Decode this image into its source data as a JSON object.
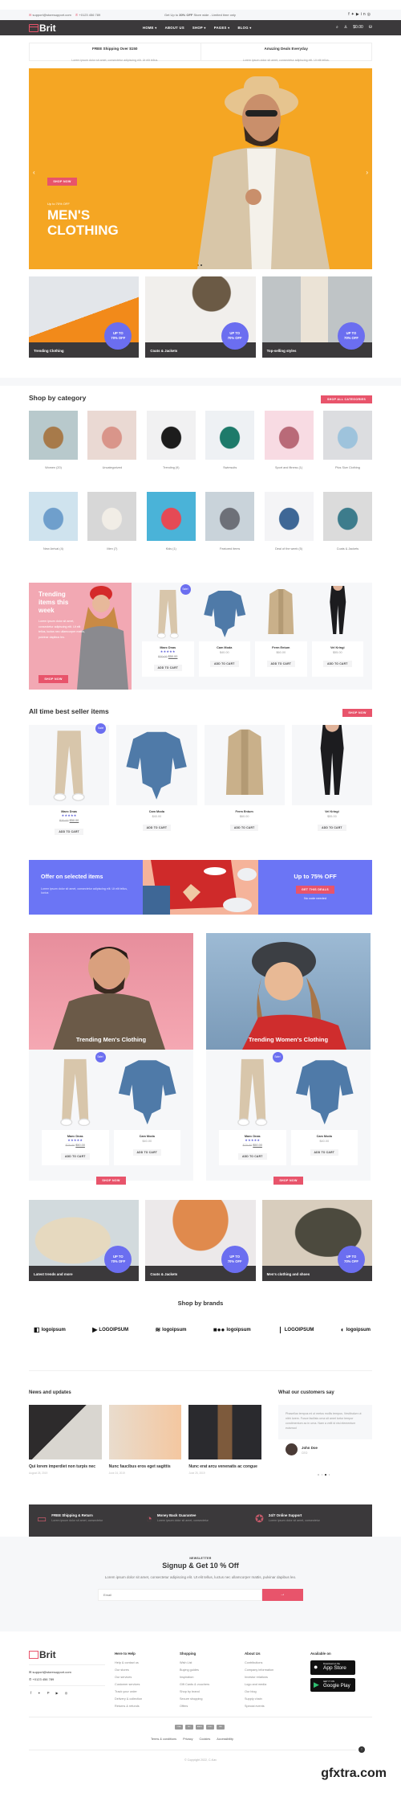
{
  "topbar": {
    "email": "support@storesupport.com",
    "phone": "+0123 456 789",
    "promo_pre": "Get Up to ",
    "promo_bold": "30% OFF",
    "promo_post": " Store wide - Limited time only",
    "social_icons": [
      "facebook-icon",
      "twitter-icon",
      "youtube-icon",
      "linkedin-icon",
      "instagram-icon"
    ]
  },
  "nav": {
    "brand": "Brit",
    "menu": [
      "HOME ▾",
      "ABOUT US",
      "SHOP ▾",
      "PAGES ▾",
      "BLOG ▾"
    ],
    "cart_total": "$0.00"
  },
  "promo_strip": [
    {
      "title": "FREE Shipping Over $150",
      "text": "Lorem ipsum dolor sit amet, consectetur adipiscing elit. Ut elit tellus."
    },
    {
      "title": "Amazing Deals Everyday",
      "text": "Lorem ipsum dolor sit amet, consectetur adipiscing elit. Ut elit tellus."
    }
  ],
  "hero": {
    "subtitle": "Up to 70% OFF",
    "title_line1": "MEN'S",
    "title_line2": "CLOTHING",
    "button": "SHOP NOW",
    "slide_count": 2,
    "active_slide": 2
  },
  "promo_tiles_top": [
    {
      "caption": "Trending Clothing",
      "badge_l1": "UP TO",
      "badge_l2": "70% OFF"
    },
    {
      "caption": "Coats & Jackets",
      "badge_l1": "UP TO",
      "badge_l2": "70% OFF"
    },
    {
      "caption": "Top-selling styles",
      "badge_l1": "UP TO",
      "badge_l2": "70% OFF"
    }
  ],
  "categories": {
    "title": "Shop by category",
    "button": "SHOP ALL CATEGORIES",
    "items": [
      "Women (20)",
      "Uncategorized",
      "Trending (9)",
      "Swimsuits",
      "Sport and fitness (1)",
      "Plus Size Clothing",
      "New Arrival (4)",
      "Men (7)",
      "Kids (1)",
      "Featured items",
      "Deal of the week (5)",
      "Coats & Jackets"
    ]
  },
  "trending": {
    "title_l1": "Trending",
    "title_l2": "items this",
    "title_l3": "week",
    "text": "Lorem ipsum dolor sit amet, consectetur adipiscing elit. Ut elit tellus, luctus nec ullamcorper mattis, pulvinar dapibus leo.",
    "button": "SHOP NOW"
  },
  "products": [
    {
      "name": "Maec Dnas",
      "stars": "★★★★★",
      "old_price": "$70.00",
      "price": "$50.00",
      "sale": "Sale!",
      "cta": "ADD TO CART"
    },
    {
      "name": "Cam Moda",
      "price": "$40.00",
      "cta": "ADD TO CART"
    },
    {
      "name": "Ferm Entum",
      "price": "$60.00",
      "cta": "ADD TO CART"
    },
    {
      "name": "Vel Kringi",
      "price": "$55.00",
      "cta": "ADD TO CART"
    }
  ],
  "bestseller": {
    "title": "All time best seller items",
    "button": "SHOP NOW"
  },
  "offer": {
    "title": "Offer on selected items",
    "text": "Lorem ipsum dolor sit amet, consectetur adipiscing elit. Ut elit tellus, luctus",
    "right_title": "Up to 75% OFF",
    "button": "GET THIS DEALS",
    "note": "No code needed"
  },
  "trend_mw": [
    {
      "caption": "Trending Men's Clothing",
      "button": "SHOP NOW"
    },
    {
      "caption": "Trending Women's Clothing",
      "button": "SHOP NOW"
    }
  ],
  "promo_tiles_bottom": [
    {
      "caption": "Latest trends and more",
      "badge_l1": "UP TO",
      "badge_l2": "70% OFF"
    },
    {
      "caption": "Coats & Jackets",
      "badge_l1": "UP TO",
      "badge_l2": "70% OFF"
    },
    {
      "caption": "Men's clothing and shoes",
      "badge_l1": "UP TO",
      "badge_l2": "70% OFF"
    }
  ],
  "brands": {
    "title": "Shop by brands",
    "items": [
      "logoipsum",
      "LOGOIPSUM",
      "logoipsum",
      "logoipsum",
      "LOGOIPSUM",
      "logoipsum"
    ]
  },
  "news": {
    "title": "News and updates",
    "items": [
      {
        "title": "Qui lorem imperdiet non turpis nec",
        "date": "August 28, 2019"
      },
      {
        "title": "Nunc faucibus eros eget sagittis",
        "date": "June 24, 2019"
      },
      {
        "title": "Nunc erat arcu venenatis ac congue",
        "date": "June 25, 2019"
      }
    ]
  },
  "testimonial": {
    "title": "What our customers say",
    "quote": "Phasellus tempus mi ut metus mollis tempus. Vestibulum ut nibh lorem. Fusce facilisis urna sit amet tortor tempor condimentum ac in urna. Nam a velit id nisi elementum euismod",
    "name": "John Doe",
    "role": "CEO",
    "slide_count": 4,
    "active_slide": 3
  },
  "features": [
    {
      "title": "FREE Shipping & Return",
      "text": "Lorem ipsum dolor sit amet, consectetur",
      "icon": "shipping-icon"
    },
    {
      "title": "Money Back Guarantee",
      "text": "Lorem ipsum dolor sit amet, consectetur",
      "icon": "money-back-icon"
    },
    {
      "title": "24/7 Online Support",
      "text": "Lorem ipsum dolor sit amet, consectetur",
      "icon": "support-icon"
    }
  ],
  "newsletter": {
    "eyebrow": "NEWSLETTER",
    "title": "Signup & Get 10 % Off",
    "text": "Lorem ipsum dolor sit amet, consectetur adipiscing elit. Ut elit tellus, luctus nec ullamcorper mattis, pulvinar dapibus leo.",
    "placeholder": "Email",
    "submit": "→"
  },
  "footer": {
    "brand": "Brit",
    "email": "support@storesupport.com",
    "phone": "+0123 456 789",
    "columns": [
      {
        "title": "Here to Help",
        "links": [
          "Help & contact us",
          "Our stores",
          "Our services",
          "Customer services",
          "Track your order",
          "Delivery & collection",
          "Returns & refunds"
        ]
      },
      {
        "title": "Shopping",
        "links": [
          "Wish List",
          "Buying guides",
          "Inspiration",
          "Gift Cards & vouchers",
          "Shop by brand",
          "Secure shopping",
          "Offers"
        ]
      },
      {
        "title": "About Us",
        "links": [
          "Contributions",
          "Company information",
          "Investor relations",
          "Logo and media",
          "Our blog",
          "Supply chain",
          "Special events"
        ]
      }
    ],
    "apps_title": "Available on",
    "appstore_small": "Download on the",
    "appstore_big": "App Store",
    "gplay_small": "GET IT ON",
    "gplay_big": "Google Play",
    "payments": [
      "VISA",
      "MC",
      "AMEX",
      "DISC",
      "PAY"
    ],
    "legal": [
      "Terms & conditions",
      "Privacy",
      "Cookies",
      "Accessibility"
    ],
    "copyright": "© Copyright 2022, C-Kav"
  },
  "watermark": "gfxtra.com",
  "colors": {
    "accent": "#e8546b",
    "purple": "#6b6ef0",
    "dark": "#3b393b",
    "hero_bg": "#f5a623"
  }
}
